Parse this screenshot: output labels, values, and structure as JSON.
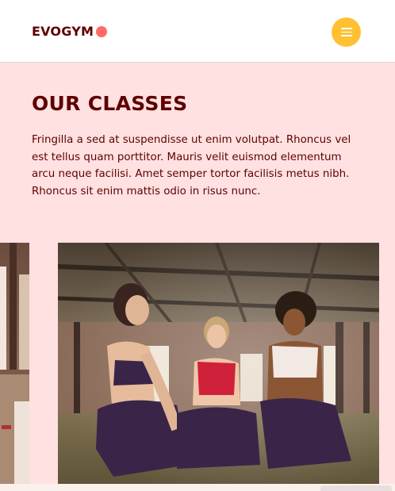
{
  "navbar": {
    "logo_text": "EVOGYM",
    "menu_icon": "hamburger-menu-icon",
    "colors": {
      "logo": "#5e0000",
      "logo_dot": "#ff6b66",
      "menu_button": "#ffc132",
      "background": "#ffffff"
    }
  },
  "classes": {
    "title": "OUR CLASSES",
    "description": "Fringilla a sed at suspendisse ut enim volutpat. Rhoncus vel est tellus quam porttitor. Mauris velit euismod elementum arcu neque facilisi. Amet semper tortor facilisis metus nibh. Rhoncus sit enim mattis odio in risus nunc.",
    "colors": {
      "background": "#ffe1e1",
      "text": "#5e0000"
    },
    "cards": [
      {
        "image": "gym-interior-photo"
      },
      {
        "image": "women-fitness-class-photo"
      }
    ]
  }
}
